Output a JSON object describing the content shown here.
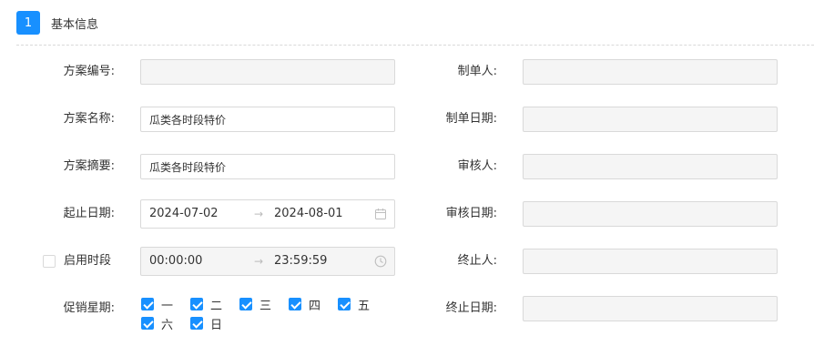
{
  "section": {
    "step": "1",
    "title": "基本信息"
  },
  "left": {
    "plan_no": {
      "label": "方案编号:",
      "value": ""
    },
    "plan_name": {
      "label": "方案名称:",
      "value": "瓜类各时段特价"
    },
    "plan_summary": {
      "label": "方案摘要:",
      "value": "瓜类各时段特价"
    },
    "date_range": {
      "label": "起止日期:",
      "start": "2024-07-02",
      "arrow": "→",
      "end": "2024-08-01"
    },
    "time_range": {
      "label": "启用时段",
      "enabled": false,
      "start": "00:00:00",
      "arrow": "→",
      "end": "23:59:59"
    },
    "weekdays": {
      "label": "促销星期:",
      "days": [
        {
          "label": "一",
          "checked": true
        },
        {
          "label": "二",
          "checked": true
        },
        {
          "label": "三",
          "checked": true
        },
        {
          "label": "四",
          "checked": true
        },
        {
          "label": "五",
          "checked": true
        },
        {
          "label": "六",
          "checked": true
        },
        {
          "label": "日",
          "checked": true
        }
      ]
    }
  },
  "right": {
    "creator": {
      "label": "制单人:",
      "value": ""
    },
    "create_date": {
      "label": "制单日期:",
      "value": ""
    },
    "reviewer": {
      "label": "审核人:",
      "value": ""
    },
    "review_date": {
      "label": "审核日期:",
      "value": ""
    },
    "terminator": {
      "label": "终止人:",
      "value": ""
    },
    "terminate_date": {
      "label": "终止日期:",
      "value": ""
    }
  },
  "colors": {
    "primary": "#1890ff",
    "border": "#d9d9d9",
    "disabled_bg": "#f5f5f5"
  },
  "icons": {
    "date_suffix": "calendar-icon",
    "time_suffix": "clock-icon"
  }
}
